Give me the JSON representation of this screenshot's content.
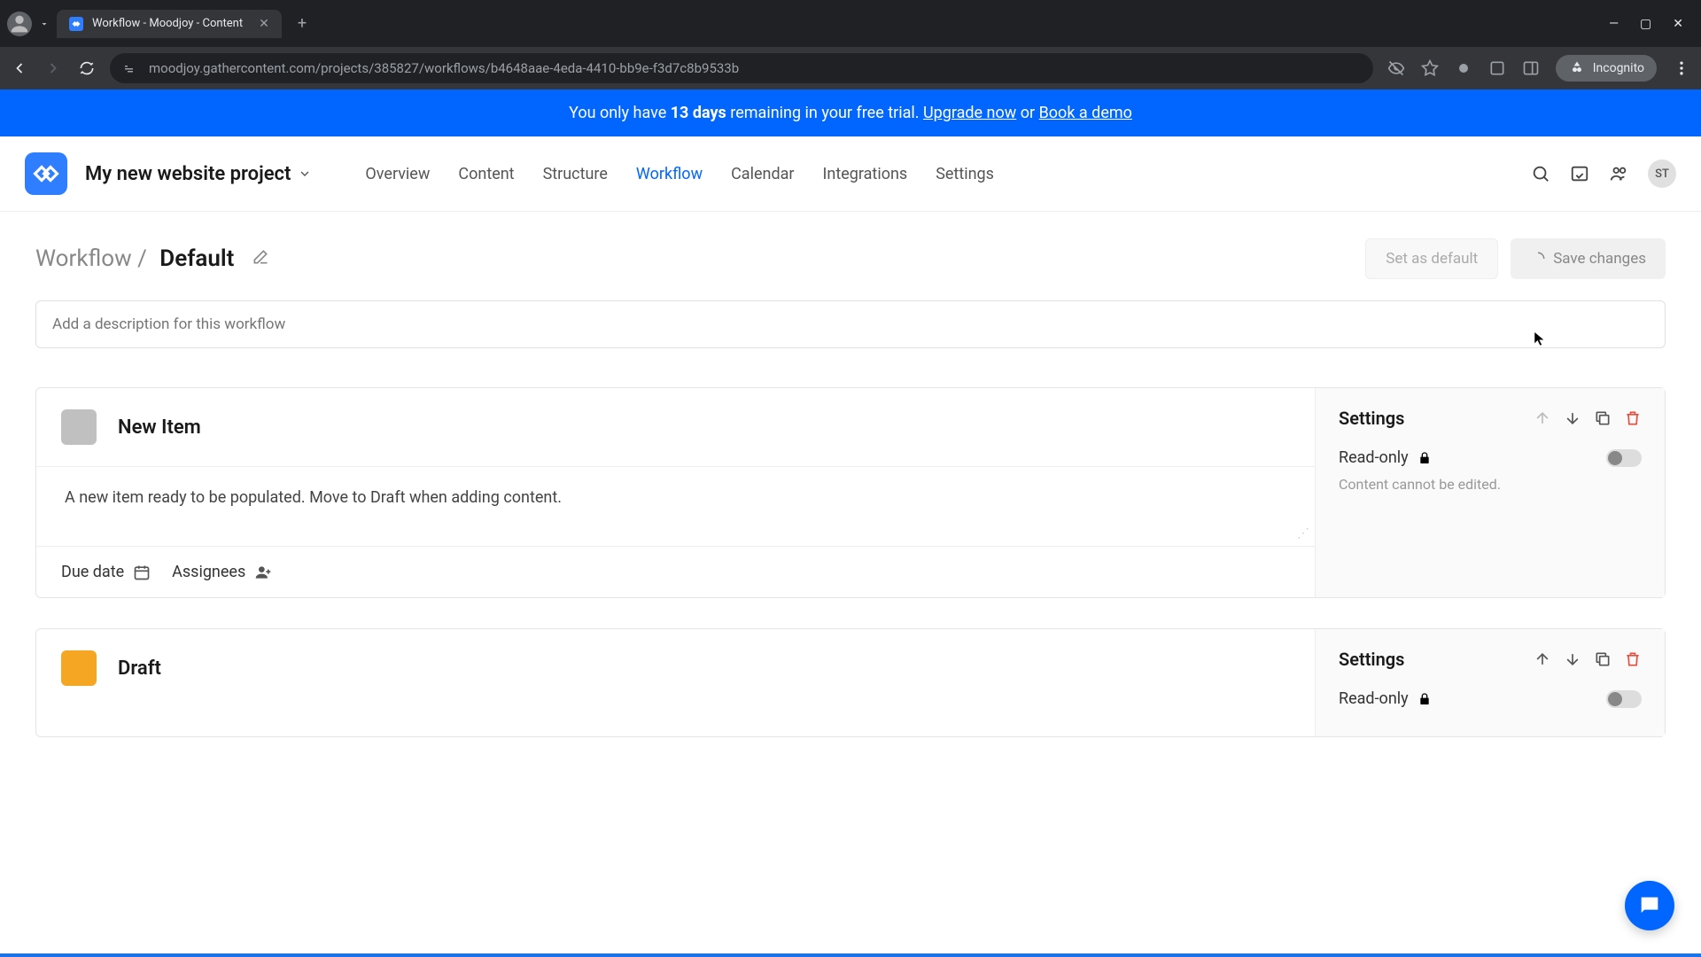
{
  "browser": {
    "tab_title": "Workflow - Moodjoy - Content",
    "url": "moodjoy.gathercontent.com/projects/385827/workflows/b4648aae-4eda-4410-bb9e-f3d7c8b9533b",
    "incognito_label": "Incognito"
  },
  "trial": {
    "prefix": "You only have ",
    "days": "13 days",
    "middle": " remaining in your free trial. ",
    "upgrade": "Upgrade now",
    "or": " or ",
    "demo": "Book a demo"
  },
  "header": {
    "project": "My new website project",
    "nav": {
      "overview": "Overview",
      "content": "Content",
      "structure": "Structure",
      "workflow": "Workflow",
      "calendar": "Calendar",
      "integrations": "Integrations",
      "settings": "Settings"
    },
    "avatar": "ST"
  },
  "page": {
    "breadcrumb_root": "Workflow /",
    "breadcrumb_current": "Default",
    "set_default": "Set as default",
    "save": "Save changes",
    "desc_placeholder": "Add a description for this workflow"
  },
  "card1": {
    "title": "New Item",
    "desc": "A new item ready to be populated. Move to Draft when adding content.",
    "due_date": "Due date",
    "assignees": "Assignees",
    "settings_title": "Settings",
    "readonly": "Read-only",
    "readonly_hint": "Content cannot be edited."
  },
  "card2": {
    "title": "Draft",
    "settings_title": "Settings",
    "readonly": "Read-only"
  }
}
